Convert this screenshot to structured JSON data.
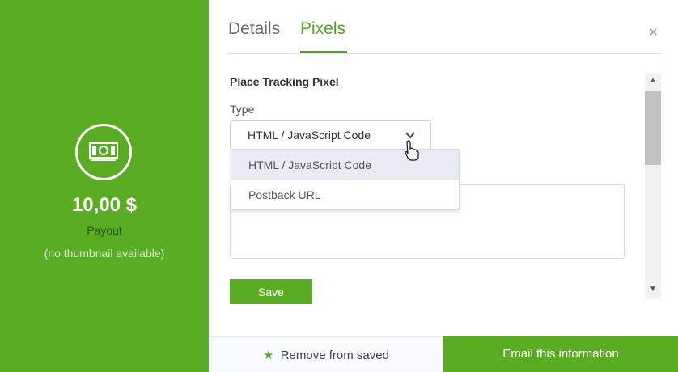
{
  "offer": {
    "icon": "money-icon",
    "payout_amount": "10,00 $",
    "payout_label": "Payout",
    "thumbnail_note": "(no thumbnail available)"
  },
  "tabs": [
    {
      "label": "Details",
      "active": false
    },
    {
      "label": "Pixels",
      "active": true
    }
  ],
  "close_icon": "×",
  "pixels": {
    "section_title": "Place Tracking Pixel",
    "type_label": "Type",
    "selected_type": "HTML / JavaScript Code",
    "options": [
      "HTML / JavaScript Code",
      "Postback URL"
    ],
    "code_value": "",
    "save_label": "Save"
  },
  "scrollbar": {
    "up_glyph": "▲",
    "down_glyph": "▼"
  },
  "footer": {
    "remove_label": "Remove from saved",
    "email_label": "Email this information"
  },
  "colors": {
    "brand_green": "#5aad22",
    "tab_active": "#4fa21c",
    "option_highlight": "#e8ebf3"
  }
}
